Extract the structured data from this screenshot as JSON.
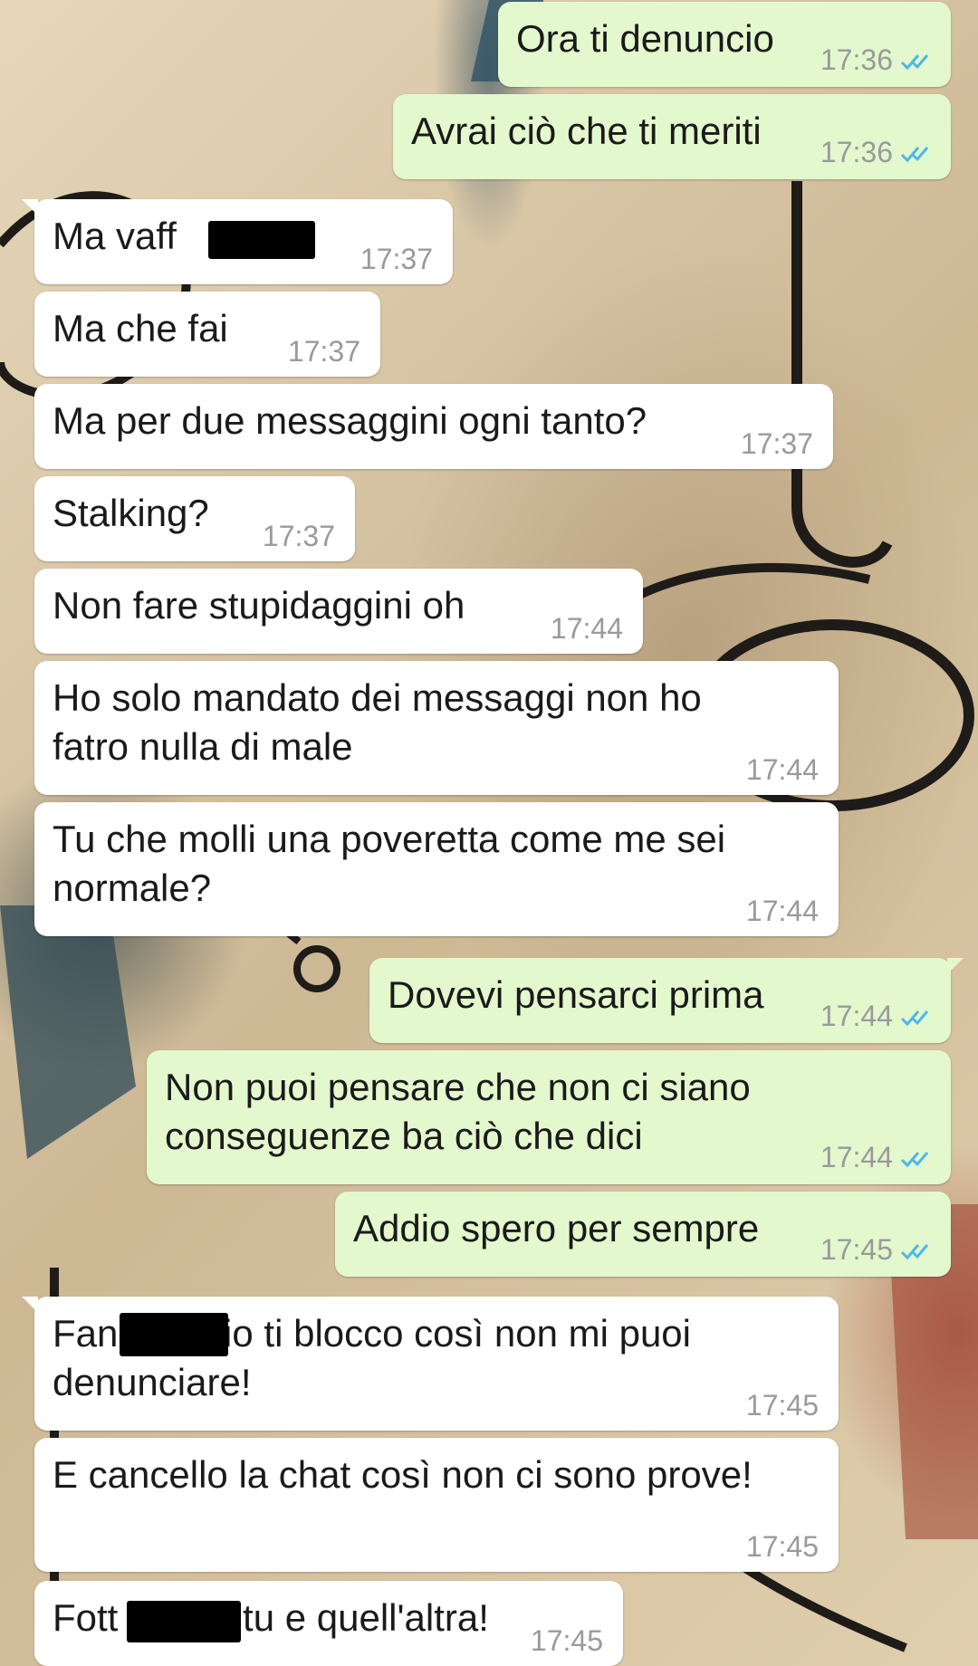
{
  "messages": [
    {
      "dir": "out",
      "text": "Ora ti denuncio",
      "time": "17:36",
      "read": true
    },
    {
      "dir": "out",
      "text": "Avrai ciò che ti meriti",
      "time": "17:36",
      "read": true
    },
    {
      "dir": "in",
      "text": "Ma vaff",
      "time": "17:37"
    },
    {
      "dir": "in",
      "text": "Ma che fai",
      "time": "17:37"
    },
    {
      "dir": "in",
      "text": "Ma per due messaggini ogni tanto?",
      "time": "17:37"
    },
    {
      "dir": "in",
      "text": "Stalking?",
      "time": "17:37"
    },
    {
      "dir": "in",
      "text": "Non fare stupidaggini oh",
      "time": "17:44"
    },
    {
      "dir": "in",
      "text_lines": [
        "Ho solo mandato dei messaggi non ho",
        "fatro nulla di male"
      ],
      "time": "17:44"
    },
    {
      "dir": "in",
      "text_lines": [
        "Tu che molli una poveretta come me sei",
        "normale?"
      ],
      "time": "17:44"
    },
    {
      "dir": "out",
      "text": "Dovevi pensarci prima",
      "time": "17:44",
      "read": true
    },
    {
      "dir": "out",
      "text_lines": [
        "Non puoi pensare che non ci siano",
        "conseguenze ba ciò che dici"
      ],
      "time": "17:44",
      "read": true
    },
    {
      "dir": "out",
      "text": "Addio spero per sempre",
      "time": "17:45",
      "read": true
    },
    {
      "dir": "in",
      "text_lines": [
        "Fan          io ti blocco così non mi puoi",
        "denunciare!"
      ],
      "time": "17:45"
    },
    {
      "dir": "in",
      "text": "E cancello la chat così non ci sono prove!",
      "time": "17:45"
    },
    {
      "dir": "in",
      "text": "Fott          i tu e quell'altra!",
      "time": "17:45"
    }
  ],
  "colors": {
    "incoming_bubble": "#ffffff",
    "outgoing_bubble": "#e3f8cd",
    "timestamp": "#9a9a9a",
    "read_ticks": "#4fb6ec",
    "censor_bar": "#000000"
  },
  "icons": {
    "read_receipt": "double-check-icon"
  }
}
